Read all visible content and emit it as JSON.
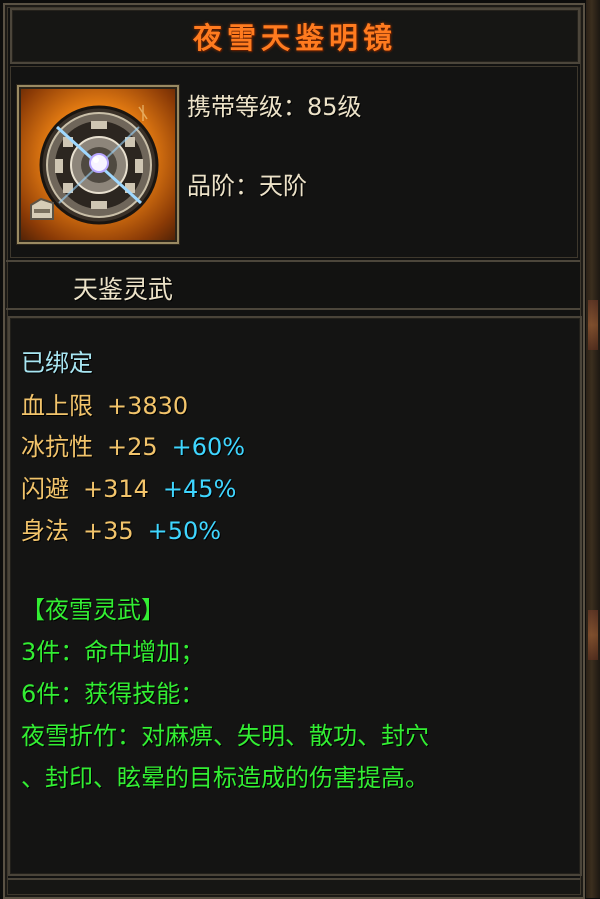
{
  "title": "夜雪天鉴明镜",
  "item_icon": "compass-mirror-icon",
  "info": {
    "level_label": "携带等级：",
    "level_value": "85级",
    "grade_label": "品阶：",
    "grade_value": "天阶"
  },
  "category": "天鉴灵武",
  "bound_text": "已绑定",
  "stats": [
    {
      "name": "血上限",
      "value": "+3830",
      "percent": ""
    },
    {
      "name": "冰抗性",
      "value": "+25",
      "percent": "+60%"
    },
    {
      "name": "闪避",
      "value": "+314",
      "percent": "+45%"
    },
    {
      "name": "身法",
      "value": "+35",
      "percent": "+50%"
    }
  ],
  "set": {
    "name": "【夜雪灵武】",
    "bonus_3": "3件：命中增加；",
    "bonus_6": "6件：获得技能：",
    "skill_line_1": "夜雪折竹：对麻痹、失明、散功、封穴",
    "skill_line_2": "、封印、眩晕的目标造成的伤害提高。"
  },
  "colors": {
    "title": "#ff7b1f",
    "bound": "#a8e6f2",
    "stat": "#f2c46b",
    "percent": "#3fd6ff",
    "set_text": "#33ee33"
  }
}
